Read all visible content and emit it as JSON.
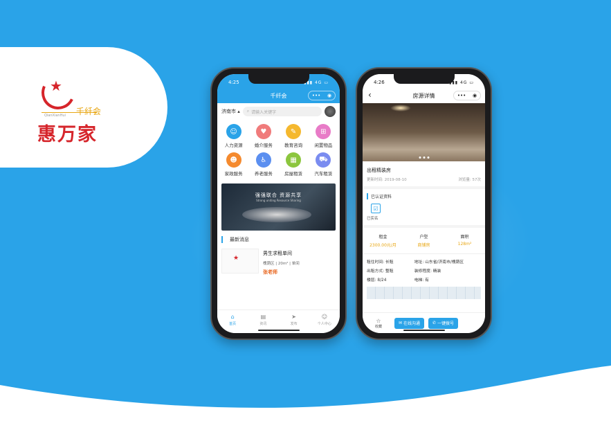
{
  "colors": {
    "accent": "#2aa3e8",
    "brand_red": "#d6252b",
    "brand_gold": "#e8a612",
    "price_orange": "#e8641c"
  },
  "logo": {
    "cn_small": "千纤会",
    "en_small": "QianXianHui",
    "cn_big": "惠万家"
  },
  "phone_home": {
    "status": {
      "time": "4:25",
      "signal": "4G"
    },
    "title": "千纤会",
    "capsule": {
      "more": "•••",
      "close": "◉"
    },
    "city": "济南市",
    "search_placeholder": "请输入关键字",
    "services": [
      {
        "label": "人力资源",
        "icon": "person-icon",
        "color": "#2aa3e8"
      },
      {
        "label": "婚介服务",
        "icon": "home-heart-icon",
        "color": "#f07b7b"
      },
      {
        "label": "教育咨询",
        "icon": "chat-icon",
        "color": "#f5b82e"
      },
      {
        "label": "闲置物品",
        "icon": "cart-icon",
        "color": "#e87bc7"
      },
      {
        "label": "家政服务",
        "icon": "housekeeper-icon",
        "color": "#f58a2e"
      },
      {
        "label": "养老服务",
        "icon": "elder-icon",
        "color": "#5b8ff0"
      },
      {
        "label": "房屋租赁",
        "icon": "building-icon",
        "color": "#8cc63e"
      },
      {
        "label": "汽车租赁",
        "icon": "car-icon",
        "color": "#7a8cf0"
      }
    ],
    "banner": {
      "title": "强强联合  资源共享",
      "subtitle": "Strong uniting   Resource Sharing"
    },
    "section_title": "最新消息",
    "listing": {
      "title": "男生求租单间",
      "district": "槐荫区",
      "area": "20m²",
      "room": "单间",
      "owner": "张老师"
    },
    "tabs": [
      {
        "label": "首页",
        "icon": "home-icon",
        "active": true
      },
      {
        "label": "资讯",
        "icon": "message-icon",
        "active": false
      },
      {
        "label": "发布",
        "icon": "send-icon",
        "active": false
      },
      {
        "label": "个人中心",
        "icon": "user-icon",
        "active": false
      }
    ]
  },
  "phone_detail": {
    "status": {
      "time": "4:26",
      "signal": "4G"
    },
    "title": "房源详情",
    "capsule": {
      "more": "•••",
      "close": "◉"
    },
    "house_title": "出租精装房",
    "updated": "更新时间: 2019-08-10",
    "views": "浏览量: 57次",
    "cert_title": "已认证资料",
    "cert_label": "已实名",
    "specs": [
      {
        "key": "租金",
        "value": "2300.00元/月"
      },
      {
        "key": "户型",
        "value": "商铺房"
      },
      {
        "key": "面积",
        "value": "128m²"
      }
    ],
    "props": [
      "租住时间: 长租",
      "地址: 山东省/济南市/槐荫区",
      "出租方式: 整租",
      "装修程度: 精装",
      "楼层: 8/24",
      "电梯: 有"
    ],
    "fav_label": "收藏",
    "chat_button": "在线沟通",
    "call_button": "一键拨号"
  }
}
